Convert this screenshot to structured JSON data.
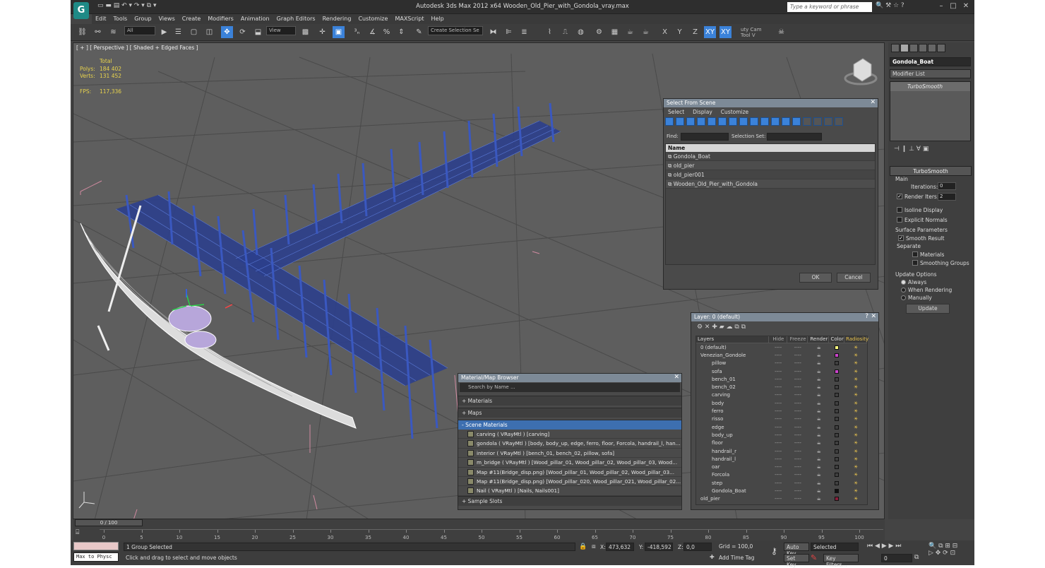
{
  "app": {
    "logo": "G",
    "title": "Autodesk 3ds Max  2012 x64     Wooden_Old_Pier_with_Gondola_vray.max",
    "search_placeholder": "Type a keyword or phrase",
    "min": "–",
    "max": "□",
    "close": "✕"
  },
  "menu": [
    "Edit",
    "Tools",
    "Group",
    "Views",
    "Create",
    "Modifiers",
    "Animation",
    "Graph Editors",
    "Rendering",
    "Customize",
    "MAXScript",
    "Help"
  ],
  "toolbar": {
    "selection_filter": "All",
    "ref_coord": "View",
    "named_selection": "Create Selection Se",
    "axes": [
      "X",
      "Y",
      "Z",
      "XY",
      "XY"
    ],
    "utility": "uty Cam Tool V"
  },
  "viewport": {
    "label": "[ + ] [ Perspective ] [ Shaded + Edged Faces ]",
    "stats_total": "Total",
    "polys_label": "Polys:",
    "polys": "184 402",
    "verts_label": "Verts:",
    "verts": "131 452",
    "fps_label": "FPS:",
    "fps": "117,336"
  },
  "select_from_scene": {
    "title": "Select From Scene",
    "menu": [
      "Select",
      "Display",
      "Customize"
    ],
    "find_label": "Find:",
    "selection_set_label": "Selection Set:",
    "col_name": "Name",
    "rows": [
      "Gondola_Boat",
      "old_pier",
      "old_pier001",
      "Wooden_Old_Pier_with_Gondola"
    ],
    "ok": "OK",
    "cancel": "Cancel"
  },
  "layers": {
    "title": "Layer: 0 (default)",
    "help": "?",
    "close": "✕",
    "columns": [
      "Layers",
      "Hide",
      "Freeze",
      "Render",
      "Color",
      "Radiosity"
    ],
    "rows": [
      {
        "name": "0 (default)",
        "mark": "✓",
        "hide": "----",
        "freeze": "----",
        "color": "#ffff80"
      },
      {
        "name": "Venezian_Gondole",
        "mark": "",
        "hide": "----",
        "freeze": "----",
        "color": "#cc44cc"
      },
      {
        "name": "pillow",
        "hide": "----",
        "freeze": "----",
        "color": "#404040"
      },
      {
        "name": "sofa",
        "hide": "----",
        "freeze": "----",
        "color": "#cc44cc"
      },
      {
        "name": "bench_01",
        "hide": "----",
        "freeze": "----",
        "color": "#404040"
      },
      {
        "name": "bench_02",
        "hide": "----",
        "freeze": "----",
        "color": "#404040"
      },
      {
        "name": "carving",
        "hide": "----",
        "freeze": "----",
        "color": "#404040"
      },
      {
        "name": "body",
        "hide": "----",
        "freeze": "----",
        "color": "#404040"
      },
      {
        "name": "ferro",
        "hide": "----",
        "freeze": "----",
        "color": "#404040"
      },
      {
        "name": "risso",
        "hide": "----",
        "freeze": "----",
        "color": "#404040"
      },
      {
        "name": "edge",
        "hide": "----",
        "freeze": "----",
        "color": "#404040"
      },
      {
        "name": "body_up",
        "hide": "----",
        "freeze": "----",
        "color": "#404040"
      },
      {
        "name": "floor",
        "hide": "----",
        "freeze": "----",
        "color": "#404040"
      },
      {
        "name": "handrail_r",
        "hide": "----",
        "freeze": "----",
        "color": "#404040"
      },
      {
        "name": "handrail_l",
        "hide": "----",
        "freeze": "----",
        "color": "#404040"
      },
      {
        "name": "oar",
        "hide": "----",
        "freeze": "----",
        "color": "#404040"
      },
      {
        "name": "Forcola",
        "hide": "----",
        "freeze": "----",
        "color": "#404040"
      },
      {
        "name": "step",
        "hide": "----",
        "freeze": "----",
        "color": "#404040"
      },
      {
        "name": "Gondola_Boat",
        "hide": "----",
        "freeze": "----",
        "color": "#111111"
      },
      {
        "name": "old_pier",
        "mark": "",
        "hide": "----",
        "freeze": "----",
        "color": "#8a1d3a"
      }
    ]
  },
  "material_browser": {
    "title": "Material/Map Browser",
    "search": "Search by Name ...",
    "sections": [
      "+ Materials",
      "+ Maps",
      "- Scene Materials",
      "+ Sample Slots"
    ],
    "items": [
      "carving  ( VRayMtl ) [carving]",
      "gondola  ( VRayMtl ) [body, body_up, edge, ferro, floor, Forcola, handrail_l, han...",
      "interior  ( VRayMtl ) [bench_01, bench_02, pillow, sofa]",
      "m_bridge  ( VRayMtl ) [Wood_pillar_01, Wood_pillar_02, Wood_pillar_03, Wood...",
      "Map #11(Bridge_disp.png) [Wood_pillar_01, Wood_pillar_02, Wood_pillar_03...",
      "Map #11(Bridge_disp.png) [Wood_pillar_020, Wood_pillar_021, Wood_pillar_02...",
      "Nail  ( VRayMtl ) [Nails, Nails001]"
    ]
  },
  "command_panel": {
    "object_name": "Gondola_Boat",
    "modifier_list": "Modifier List",
    "stack_item": "TurboSmooth",
    "rollout": "TurboSmooth",
    "main": "Main",
    "iterations_label": "Iterations:",
    "iterations": "0",
    "render_iters_label": "Render Iters:",
    "render_iters": "2",
    "isoline": "Isoline Display",
    "explicit": "Explicit Normals",
    "surface": "Surface Parameters",
    "smooth_result": "Smooth Result",
    "separate": "Separate",
    "materials": "Materials",
    "smoothing_groups": "Smoothing Groups",
    "update_options": "Update Options",
    "always": "Always",
    "when_rendering": "When Rendering",
    "manually": "Manually",
    "update": "Update"
  },
  "timeline": {
    "slider": "0 / 100",
    "ticks": [
      "0",
      "5",
      "10",
      "15",
      "20",
      "25",
      "30",
      "35",
      "40",
      "45",
      "50",
      "55",
      "60",
      "65",
      "70",
      "75",
      "80",
      "85",
      "90",
      "95",
      "100"
    ]
  },
  "status": {
    "maxscript": "Max to Physc",
    "selected": "1 Group Selected",
    "prompt": "Click and drag to select and move objects",
    "x_label": "X:",
    "x": "473,632",
    "y_label": "Y:",
    "y": "-418,592",
    "z_label": "Z:",
    "z": "0,0",
    "grid": "Grid = 100,0",
    "add_time_tag": "Add Time Tag",
    "auto_key": "Auto Key",
    "set_key": "Set Key",
    "key_mode": "Selected",
    "key_filters": "Key Filters...",
    "frame": "0"
  }
}
